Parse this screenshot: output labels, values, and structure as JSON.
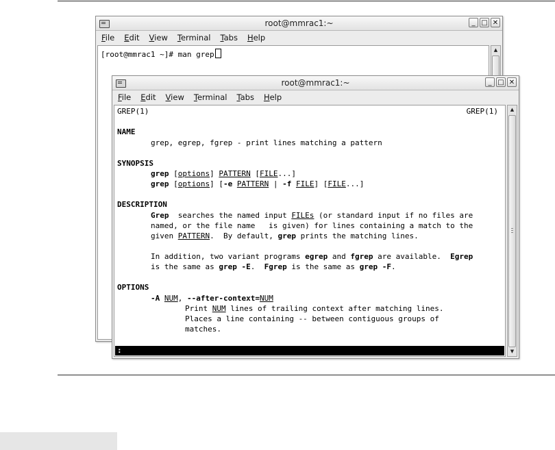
{
  "back_window": {
    "title": "root@mmrac1:~",
    "menu": [
      "File",
      "Edit",
      "View",
      "Terminal",
      "Tabs",
      "Help"
    ],
    "prompt": "[root@mmrac1 ~]# man grep"
  },
  "front_window": {
    "title": "root@mmrac1:~",
    "menu": [
      "File",
      "Edit",
      "View",
      "Terminal",
      "Tabs",
      "Help"
    ],
    "header_left": "GREP(1)",
    "header_right": "GREP(1)",
    "name_heading": "NAME",
    "name_line": "grep, egrep, fgrep - print lines matching a pattern",
    "synopsis_heading": "SYNOPSIS",
    "syn1": {
      "cmd": "grep",
      "sp": " [",
      "options": "options",
      "rb": "] ",
      "pattern": "PATTERN",
      "lb": " [",
      "file": "FILE",
      "tail": "...]"
    },
    "syn2": {
      "cmd": "grep",
      "sp": " [",
      "options": "options",
      "mid": "] [",
      "e": "-e",
      "sp2": " ",
      "pattern": "PATTERN",
      "pipe": " | ",
      "f": "-f",
      "sp3": " ",
      "file": "FILE",
      "rb": "] [",
      "file2": "FILE",
      "tail": "...]"
    },
    "description_heading": "DESCRIPTION",
    "desc1": {
      "grep": "Grep",
      "a": "  searches the named input ",
      "files": "FILEs",
      "b": " (or standard input if no files are"
    },
    "desc2": "named, or the file name   is given) for lines containing a match to the",
    "desc3": {
      "a": "given ",
      "pattern": "PATTERN",
      "b": ".  By default, ",
      "grep": "grep",
      "c": " prints the matching lines."
    },
    "desc4": {
      "a": "In addition, two variant programs ",
      "egrep": "egrep",
      "b": " and ",
      "fgrep": "fgrep",
      "c": " are available.  ",
      "Egrep": "Egrep"
    },
    "desc5": {
      "a": "is the same as ",
      "grepE": "grep -E",
      "b": ".  ",
      "Fgrep": "Fgrep",
      "c": " is the same as ",
      "grepF": "grep -F",
      "d": "."
    },
    "options_heading": "OPTIONS",
    "opt1": {
      "flag": "-A",
      "sp": " ",
      "num": "NUM",
      "comma": ", ",
      "long": "--after-context=",
      "num2": "NUM"
    },
    "opt2": {
      "a": "Print ",
      "num": "NUM",
      "b": " lines of trailing context after matching lines."
    },
    "opt3": "Places a line containing -- between contiguous groups of",
    "opt4": "matches.",
    "status_prompt": ":"
  }
}
